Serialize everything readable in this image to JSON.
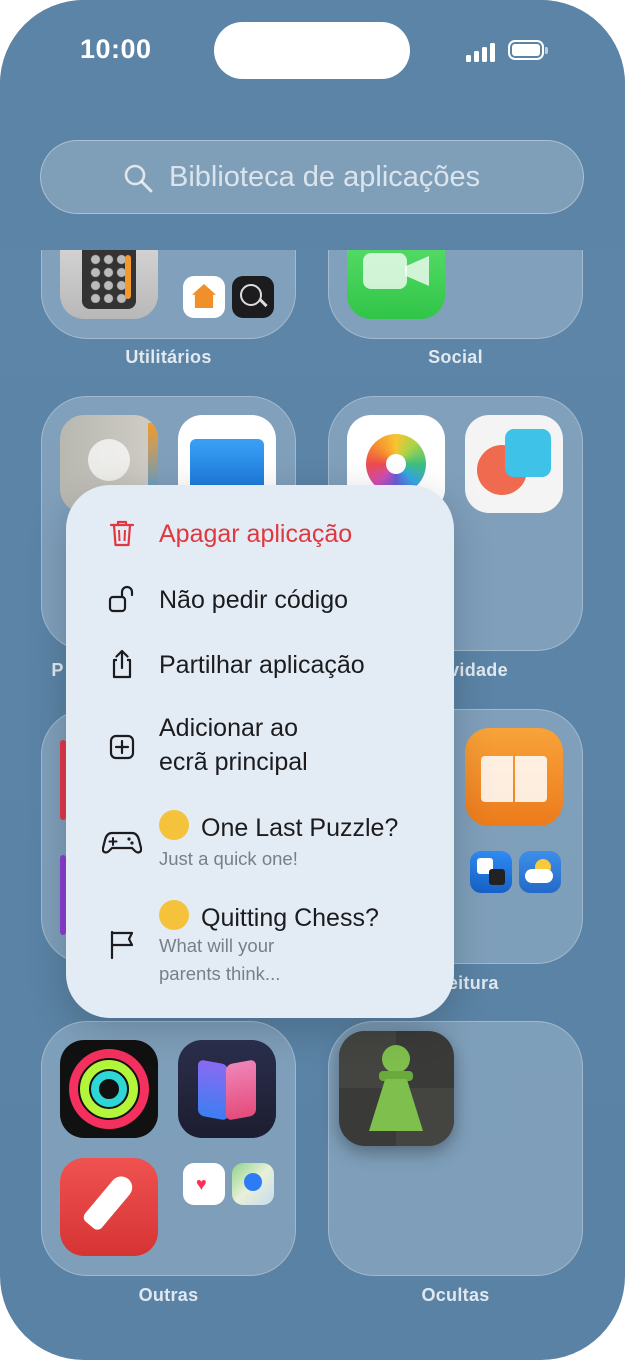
{
  "status_bar": {
    "time": "10:00"
  },
  "search": {
    "placeholder": "Biblioteca de aplicações"
  },
  "folders": [
    {
      "label": "Utilitários"
    },
    {
      "label": "Social"
    },
    {
      "label": "P"
    },
    {
      "label": "vidade"
    },
    {
      "label": "ão e leitura"
    },
    {
      "label": "Outras"
    },
    {
      "label": "Ocultas"
    }
  ],
  "context_menu": {
    "items": [
      {
        "label": "Apagar aplicação",
        "icon": "trash-icon",
        "color": "#e0383e"
      },
      {
        "label": "Não pedir código",
        "icon": "unlock-icon"
      },
      {
        "label": "Partilhar aplicação",
        "icon": "share-icon"
      },
      {
        "label_line1": "Adicionar ao",
        "label_line2": "ecrã principal",
        "icon": "add-square-icon"
      },
      {
        "label": "One Last Puzzle?",
        "subtitle": "Just a quick one!",
        "icon": "gamecontroller-icon",
        "emoji": "winking-face"
      },
      {
        "label": "Quitting Chess?",
        "subtitle_line1": "What will your",
        "subtitle_line2": "parents think...",
        "icon": "flag-icon",
        "emoji": "crying-face"
      }
    ]
  }
}
